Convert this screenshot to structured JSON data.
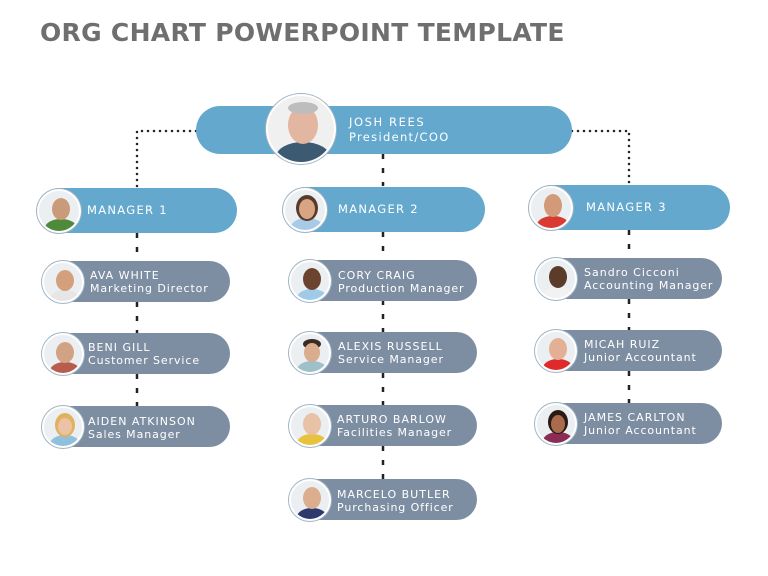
{
  "title": "ORG CHART POWERPOINT TEMPLATE",
  "colors": {
    "title": "#6f6f71",
    "primary_pill": "#64a8cd",
    "secondary_pill": "#7e8ea2",
    "connector": "#222222"
  },
  "ceo": {
    "name": "JOSH REES",
    "role": "President/COO",
    "avatar": "person-photo-icon"
  },
  "managers": [
    {
      "name": "MANAGER 1",
      "reports": [
        {
          "name": "AVA WHITE",
          "role": "Marketing Director"
        },
        {
          "name": "BENI GILL",
          "role": "Customer Service"
        },
        {
          "name": "AIDEN ATKINSON",
          "role": "Sales Manager"
        }
      ]
    },
    {
      "name": "MANAGER 2",
      "reports": [
        {
          "name": "CORY CRAIG",
          "role": "Production Manager"
        },
        {
          "name": "ALEXIS RUSSELL",
          "role": "Service Manager"
        },
        {
          "name": "ARTURO BARLOW",
          "role": "Facilities Manager"
        },
        {
          "name": "MARCELO BUTLER",
          "role": "Purchasing Officer"
        }
      ]
    },
    {
      "name": "MANAGER 3",
      "reports": [
        {
          "name": "Sandro Cicconi",
          "role": "Accounting Manager"
        },
        {
          "name": "MICAH RUIZ",
          "role": "Junior Accountant"
        },
        {
          "name": "JAMES CARLTON",
          "role": "Junior Accountant"
        }
      ]
    }
  ]
}
